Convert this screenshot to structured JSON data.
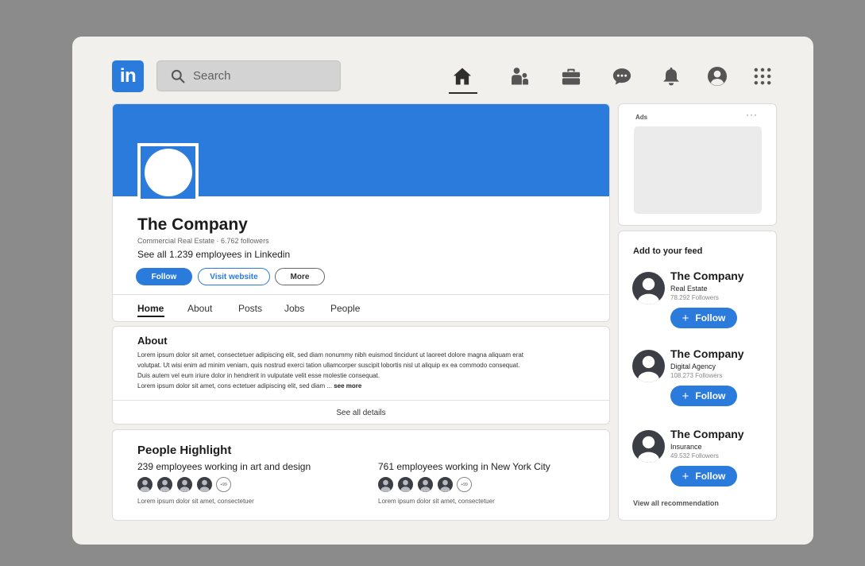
{
  "topnav": {
    "logo_text": "in",
    "search_placeholder": "Search",
    "icons": [
      "home-icon",
      "my-network-icon",
      "jobs-icon",
      "messaging-icon",
      "notifications-icon",
      "profile-icon",
      "apps-grid-icon"
    ],
    "active": "home"
  },
  "profile": {
    "name": "The Company",
    "meta": "Commercial Real Estate · 6.762 followers",
    "employees_link": "See all 1.239 employees in Linkedin",
    "buttons": {
      "follow": "Follow",
      "visit": "Visit website",
      "more": "More"
    },
    "tabs": [
      "Home",
      "About",
      "Posts",
      "Jobs",
      "People"
    ]
  },
  "about": {
    "title": "About",
    "lines": [
      "Lorem ipsum dolor sit amet, consectetuer adipiscing elit, sed diam nonummy nibh euismod tincidunt ut laoreet dolore magna aliquam erat",
      "volutpat. Ut wisi enim ad minim veniam, quis nostrud exerci tation ullamcorper suscipit lobortis nisl ut aliquip ex ea commodo consequat.",
      "Duis autem vel eum iriure dolor in hendrerit in vulputate velit esse molestie consequat.",
      "Lorem ipsum dolor sit amet, cons ectetuer adipiscing elit, sed diam ..."
    ],
    "see_more": "see more",
    "see_all": "See all details"
  },
  "people": {
    "title": "People Highlight",
    "columns": [
      {
        "title": "239 employees working in art and design",
        "more": "+99",
        "caption": "Lorem ipsum dolor sit amet, consectetuer"
      },
      {
        "title": "761 employees working in New York City",
        "more": "+99",
        "caption": "Lorem ipsum dolor sit amet, consectetuer"
      }
    ]
  },
  "ads": {
    "label": "Ads",
    "menu": "···"
  },
  "feed": {
    "title": "Add to your feed",
    "items": [
      {
        "name": "The Company",
        "industry": "Real Estate",
        "followers": "78.292 Followers",
        "follow": "Follow"
      },
      {
        "name": "The Company",
        "industry": "Digital Agency",
        "followers": "108.273 Followers",
        "follow": "Follow"
      },
      {
        "name": "The Company",
        "industry": "Insurance",
        "followers": "49.532 Followers",
        "follow": "Follow"
      }
    ],
    "view_all": "View all recommendation"
  },
  "colors": {
    "brand": "#2a7bdb",
    "background": "#8a8b8a",
    "frame": "#f1f0ec"
  }
}
